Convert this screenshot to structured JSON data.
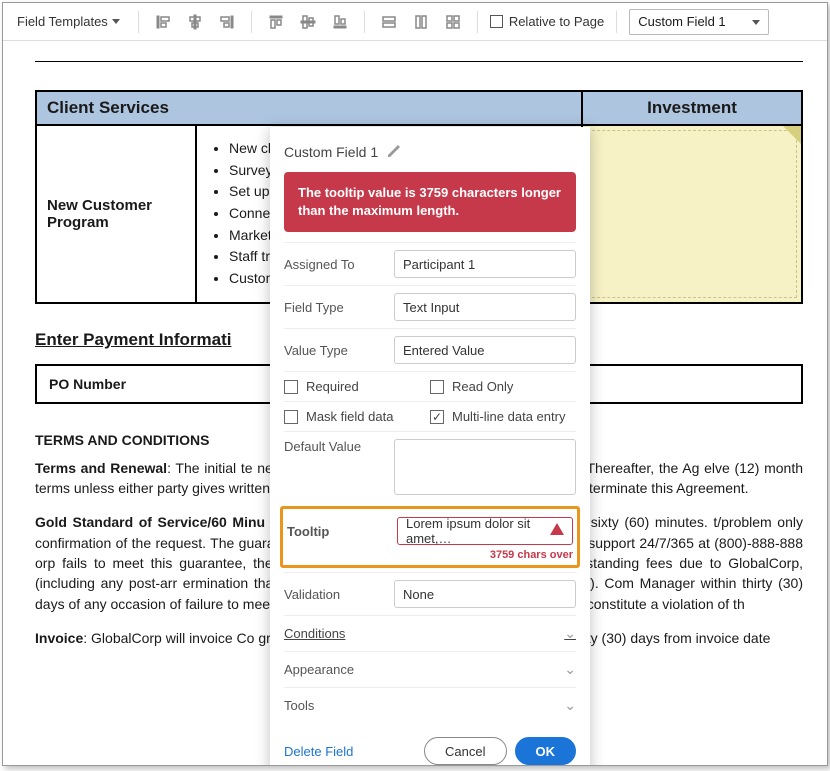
{
  "toolbar": {
    "templates_label": "Field Templates",
    "relative_label": "Relative to Page",
    "field_selector": "Custom Field 1"
  },
  "table": {
    "header_left": "Client Services",
    "header_right": "Investment",
    "program_name": "New Customer Program",
    "bullets": [
      "New client",
      "Survey (",
      "Set up p",
      "Connec",
      "Market",
      "Staff tra",
      "Custom"
    ]
  },
  "payment": {
    "section_title": "Enter Payment Informati",
    "po_label": "PO Number"
  },
  "terms": {
    "heading": "TERMS AND CONDITIONS",
    "p1_bold": "Terms and Renewal",
    "p1_rest": ": The initial te                                                                                               nencing upon the execution date of this Agreement. Thereafter, the Ag                                                                                         elve (12) month terms unless either party gives written notice to the ot                                                                                           en current term, stating its intent to terminate this Agreement.",
    "p2_bold": "Gold Standard of Service/60 Minu",
    "p2_rest": "                                                                                            to any Company customer support request within sixty (60) minutes.                                                                                                  t/problem only confirmation of the request. The guarantee only appl                                                                                               ion. GlobalCorp provides customer support 24/7/365 at (800)-888-888                                                                                              orp fails to meet this guarantee, the Company has the right to termin                                                                                              ent of all outstanding fees due to GlobalCorp, (including any post-arr                                                                                            ermination that are scheduled to be consumed after termination). Com                                                                                              Manager within thirty (30) days of any occasion of failure to meet this                                                                                           ajeure as covered in this Agreement shall not constitute a violation of th",
    "p3_bold": "Invoice",
    "p3_rest": ": GlobalCorp will invoice Co                                                                                             greement and payment shall be due no later than thirty (30) days from invoice date"
  },
  "panel": {
    "title": "Custom Field 1",
    "alert": "The tooltip value is 3759 characters longer than the maximum length.",
    "rows": {
      "assigned_label": "Assigned To",
      "assigned_value": "Participant 1",
      "fieldtype_label": "Field Type",
      "fieldtype_value": "Text Input",
      "valuetype_label": "Value Type",
      "valuetype_value": "Entered Value",
      "required_label": "Required",
      "readonly_label": "Read Only",
      "mask_label": "Mask field data",
      "multiline_label": "Multi-line data entry",
      "default_label": "Default Value",
      "tooltip_label": "Tooltip",
      "tooltip_value": "Lorem ipsum dolor sit amet,…",
      "tooltip_over": "3759 chars over",
      "validation_label": "Validation",
      "validation_value": "None",
      "conditions_label": "Conditions",
      "appearance_label": "Appearance",
      "tools_label": "Tools"
    },
    "footer": {
      "delete": "Delete Field",
      "cancel": "Cancel",
      "ok": "OK"
    }
  }
}
